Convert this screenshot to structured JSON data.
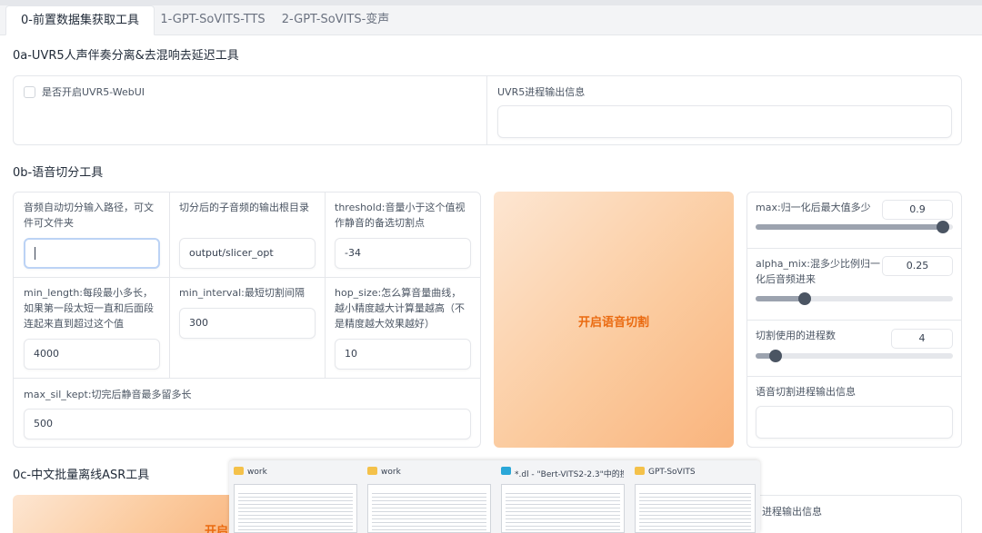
{
  "tabs": [
    {
      "label": "0-前置数据集获取工具",
      "active": true
    },
    {
      "label": "1-GPT-SoVITS-TTS",
      "active": false
    },
    {
      "label": "2-GPT-SoVITS-变声",
      "active": false
    }
  ],
  "uvr5": {
    "title": "0a-UVR5人声伴奏分离&去混响去延迟工具",
    "checkbox_label": "是否开启UVR5-WebUI",
    "checkbox_checked": false,
    "output_label": "UVR5进程输出信息",
    "output_value": ""
  },
  "slicer": {
    "title": "0b-语音切分工具",
    "input_path": {
      "label": "音频自动切分输入路径，可文件可文件夹",
      "value": ""
    },
    "output_root": {
      "label": "切分后的子音频的输出根目录",
      "value": "output/slicer_opt"
    },
    "threshold": {
      "label": "threshold:音量小于这个值视作静音的备选切割点",
      "value": "-34"
    },
    "min_length": {
      "label": "min_length:每段最小多长，如果第一段太短一直和后面段连起来直到超过这个值",
      "value": "4000"
    },
    "min_interval": {
      "label": "min_interval:最短切割间隔",
      "value": "300"
    },
    "hop_size": {
      "label": "hop_size:怎么算音量曲线，越小精度越大计算量越高（不是精度越大效果越好）",
      "value": "10"
    },
    "max_sil_kept": {
      "label": "max_sil_kept:切完后静音最多留多长",
      "value": "500"
    },
    "start_button": "开启语音切割",
    "max": {
      "label": "max:归一化后最大值多少",
      "value": "0.9",
      "fraction": 0.95
    },
    "alpha_mix": {
      "label": "alpha_mix:混多少比例归一化后音频进来",
      "value": "0.25",
      "fraction": 0.25
    },
    "n_process": {
      "label": "切割使用的进程数",
      "value": "4",
      "fraction": 0.1
    },
    "output_info_label": "语音切割进程输出信息",
    "output_info_value": ""
  },
  "asr": {
    "title": "0c-中文批量离线ASR工具",
    "button_partial": "开启",
    "output_label_partial": "进程输出信息"
  },
  "taskbar": [
    {
      "title": "work",
      "icon": "folder-icon"
    },
    {
      "title": "work",
      "icon": "folder-icon"
    },
    {
      "title": "*.dl - \"Bert-VITS2-2.3\"中的搜...",
      "icon": "document-icon"
    },
    {
      "title": "GPT-SoVITS",
      "icon": "folder-icon"
    }
  ],
  "colors": {
    "accent_orange": "#ea6a10",
    "button_gradient_start": "#fde6d2",
    "button_gradient_end": "#f9b47d",
    "slider_thumb": "#4b5563"
  }
}
